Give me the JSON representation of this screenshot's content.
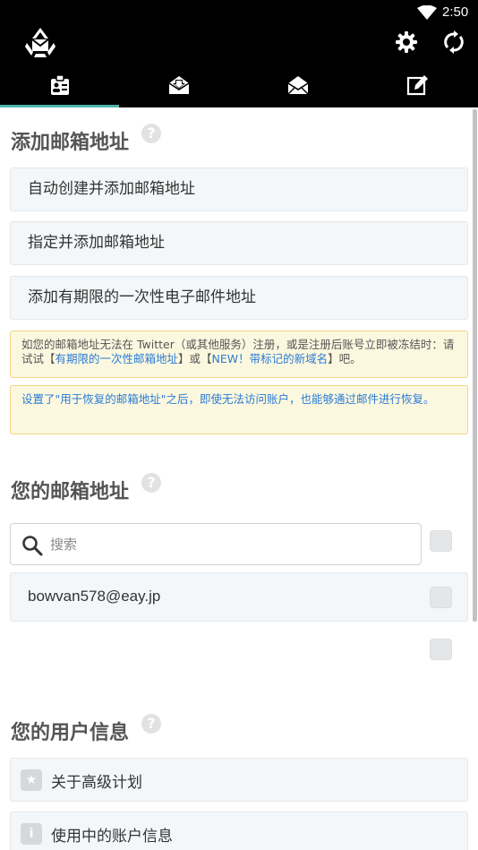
{
  "status_bar": {
    "time": "2:50"
  },
  "app": {
    "icons": {
      "logo": "mail-recycle-logo",
      "settings": "gear-icon",
      "refresh": "sync-icon"
    },
    "tabs": [
      {
        "icon": "contact-card-icon",
        "active": true
      },
      {
        "icon": "inbox-icon",
        "active": false
      },
      {
        "icon": "open-mail-icon",
        "active": false
      },
      {
        "icon": "compose-icon",
        "active": false
      }
    ],
    "accent_color": "#4fb5ae"
  },
  "add_section": {
    "title": "添加邮箱地址",
    "help": "?",
    "items": [
      {
        "label": "自动创建并添加邮箱地址"
      },
      {
        "label": "指定并添加邮箱地址"
      },
      {
        "label": "添加有期限的一次性电子邮件地址"
      }
    ],
    "notice1": {
      "text_before": "如您的邮箱地址无法在 Twitter（或其他服务）注册，或是注册后账号立即被冻结时：请试试【",
      "link1": "有期限的一次性邮箱地址",
      "text_mid": "】或【",
      "link2": "NEW！带标记的新域名",
      "text_after": "】吧。"
    },
    "notice2": {
      "text": "设置了\"用于恢复的邮箱地址\"之后，即使无法访问账户，也能够通过邮件进行恢复。"
    }
  },
  "mail_section": {
    "title": "您的邮箱地址",
    "help": "?",
    "search_placeholder": "搜索",
    "addresses": [
      {
        "address": "bowvan578@eay.jp"
      }
    ]
  },
  "user_section": {
    "title": "您的用户信息",
    "help": "?",
    "items": [
      {
        "icon": "star-icon",
        "glyph": "★",
        "label": "关于高级计划"
      },
      {
        "icon": "info-icon",
        "glyph": "i",
        "label": "使用中的账户信息"
      }
    ]
  }
}
